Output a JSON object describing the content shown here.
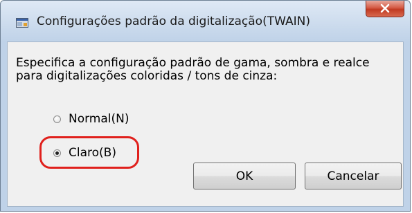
{
  "window": {
    "title": "Configurações padrão da digitalização(TWAIN)",
    "icon": "scanner-app-icon",
    "close_icon": "close-x-icon"
  },
  "dialog": {
    "description": "Especifica a configuração padrão de gama, sombra e realce\npara digitalizações coloridas / tons de cinza:",
    "options": [
      {
        "label": "Normal(N)",
        "checked": false
      },
      {
        "label": "Claro(B)",
        "checked": true
      }
    ],
    "highlight_color": "#e0201c",
    "buttons": {
      "ok_label": "OK",
      "cancel_label": "Cancelar"
    }
  }
}
